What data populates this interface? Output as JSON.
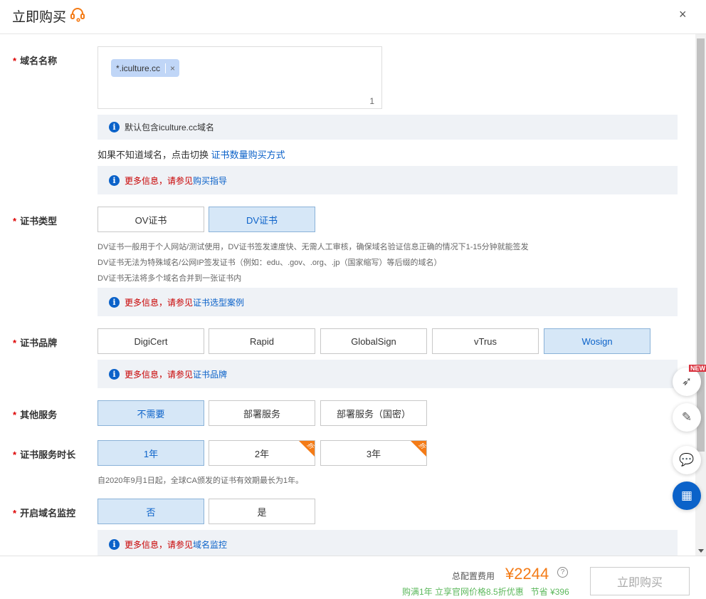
{
  "header": {
    "title": "立即购买",
    "close": "×"
  },
  "domain": {
    "label": "域名名称",
    "chip": "*.iculture.cc",
    "chip_remove": "×",
    "count": "1",
    "info": "默认包含iculture.cc域名",
    "switch_text": "如果不知道域名，点击切换",
    "switch_link": "证书数量购买方式",
    "more_prefix": "更多信息，请参见",
    "more_link": "购买指导"
  },
  "cert_type": {
    "label": "证书类型",
    "options": [
      "OV证书",
      "DV证书"
    ],
    "selected": "DV证书",
    "desc": [
      "DV证书一般用于个人网站/测试使用，DV证书签发速度快、无需人工审核，确保域名验证信息正确的情况下1-15分钟就能签发",
      "DV证书无法为特殊域名/公网IP签发证书（例如：edu、.gov、.org、.jp（国家缩写）等后缀的域名）",
      "DV证书无法将多个域名合并到一张证书内"
    ],
    "more_prefix": "更多信息，请参见",
    "more_link": "证书选型案例"
  },
  "brand": {
    "label": "证书品牌",
    "options": [
      "DigiCert",
      "Rapid",
      "GlobalSign",
      "vTrus",
      "Wosign"
    ],
    "selected": "Wosign",
    "more_prefix": "更多信息，请参见",
    "more_link": "证书品牌"
  },
  "other": {
    "label": "其他服务",
    "options": [
      "不需要",
      "部署服务",
      "部署服务（国密）"
    ],
    "selected": "不需要"
  },
  "duration": {
    "label": "证书服务时长",
    "options": [
      "1年",
      "2年",
      "3年"
    ],
    "selected": "1年",
    "discount_tag": "折",
    "note": "自2020年9月1日起，全球CA颁发的证书有效期最长为1年。"
  },
  "monitor": {
    "label": "开启域名监控",
    "options": [
      "否",
      "是"
    ],
    "selected": "否",
    "more_prefix": "更多信息，请参见",
    "more_link": "域名监控"
  },
  "float": {
    "new_badge": "NEW"
  },
  "footer": {
    "total_label": "总配置费用",
    "price": "¥2244",
    "promo": "购满1年 立享官网价格8.5折优惠",
    "save_label": "节省",
    "save": "¥396",
    "buy": "立即购买"
  },
  "colors": {
    "accent": "#0b62c9",
    "price": "#f47b16",
    "promo": "#5cb85c"
  }
}
